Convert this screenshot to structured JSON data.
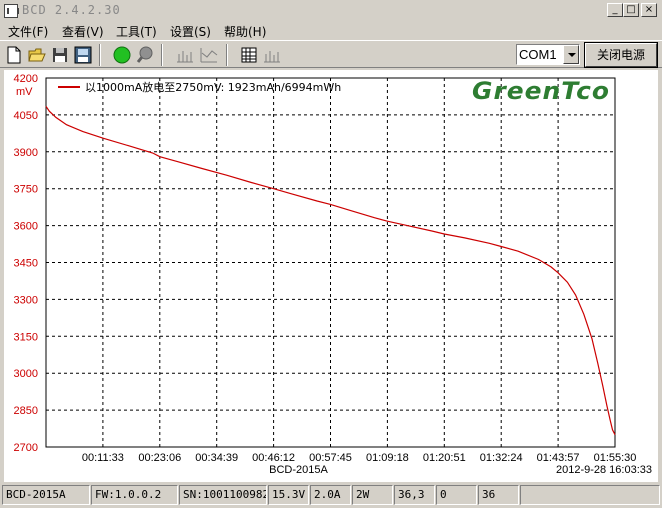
{
  "window": {
    "title": "BCD 2.4.2.30"
  },
  "menu": [
    {
      "label": "文件(F)"
    },
    {
      "label": "查看(V)"
    },
    {
      "label": "工具(T)"
    },
    {
      "label": "设置(S)"
    },
    {
      "label": "帮助(H)"
    }
  ],
  "toolbar": {
    "port_value": "COM1",
    "power_label": "关闭电源"
  },
  "chart": {
    "logo": "GreenTco",
    "legend": "以1000mA放电至2750mV: 1923mAh/6994mWh",
    "xlabel": "BCD-2015A",
    "ylabel_unit": "mV",
    "timestamp": "2012-9-28 16:03:33",
    "colors": {
      "line": "#cc0000",
      "axis_text": "#cc0000",
      "grid": "#000000",
      "logo": "#2e7d32"
    }
  },
  "chart_data": {
    "type": "line",
    "title": "",
    "xlabel": "BCD-2015A",
    "ylabel": "mV",
    "ylim": [
      2700,
      4200
    ],
    "xlim": [
      0,
      5730
    ],
    "grid": true,
    "legend_position": "top-left",
    "x_ticks": [
      {
        "t": 693,
        "label": "00:11:33"
      },
      {
        "t": 1386,
        "label": "00:23:06"
      },
      {
        "t": 2079,
        "label": "00:34:39"
      },
      {
        "t": 2772,
        "label": "00:46:12"
      },
      {
        "t": 3465,
        "label": "00:57:45"
      },
      {
        "t": 4158,
        "label": "01:09:18"
      },
      {
        "t": 4851,
        "label": "01:20:51"
      },
      {
        "t": 5544,
        "label": "01:32:24"
      },
      {
        "t": 6237,
        "label": "01:43:57"
      },
      {
        "t": 6930,
        "label": "01:55:30"
      }
    ],
    "y_ticks": [
      {
        "v": 4200,
        "label": "4200"
      },
      {
        "v": 4050,
        "label": "4050"
      },
      {
        "v": 3900,
        "label": "3900"
      },
      {
        "v": 3750,
        "label": "3750"
      },
      {
        "v": 3600,
        "label": "3600"
      },
      {
        "v": 3450,
        "label": "3450"
      },
      {
        "v": 3300,
        "label": "3300"
      },
      {
        "v": 3150,
        "label": "3150"
      },
      {
        "v": 3000,
        "label": "3000"
      },
      {
        "v": 2850,
        "label": "2850"
      },
      {
        "v": 2700,
        "label": "2700"
      }
    ],
    "series": [
      {
        "name": "以1000mA放电至2750mV: 1923mAh/6994mWh",
        "x": [
          0,
          40,
          120,
          250,
          450,
          700,
          1000,
          1300,
          1386,
          1600,
          1900,
          2200,
          2500,
          2772,
          3000,
          3300,
          3465,
          3700,
          4000,
          4158,
          4400,
          4700,
          4851,
          5100,
          5400,
          5544,
          5750,
          6000,
          6150,
          6237,
          6350,
          6450,
          6550,
          6650,
          6720,
          6780,
          6830,
          6870,
          6900,
          6930
        ],
        "y": [
          4085,
          4065,
          4040,
          4010,
          3982,
          3955,
          3925,
          3895,
          3880,
          3860,
          3832,
          3805,
          3775,
          3750,
          3728,
          3700,
          3686,
          3662,
          3632,
          3618,
          3600,
          3578,
          3566,
          3550,
          3528,
          3515,
          3496,
          3462,
          3432,
          3408,
          3370,
          3318,
          3240,
          3140,
          3040,
          2950,
          2870,
          2810,
          2770,
          2750
        ]
      }
    ]
  },
  "status": [
    {
      "text": "BCD-2015A"
    },
    {
      "text": "FW:1.0.0.2"
    },
    {
      "text": "SN:1001100982"
    },
    {
      "text": "15.3V"
    },
    {
      "text": "2.0A"
    },
    {
      "text": "2W"
    },
    {
      "text": "36,3"
    },
    {
      "text": "0"
    },
    {
      "text": "36"
    },
    {
      "text": ""
    }
  ]
}
